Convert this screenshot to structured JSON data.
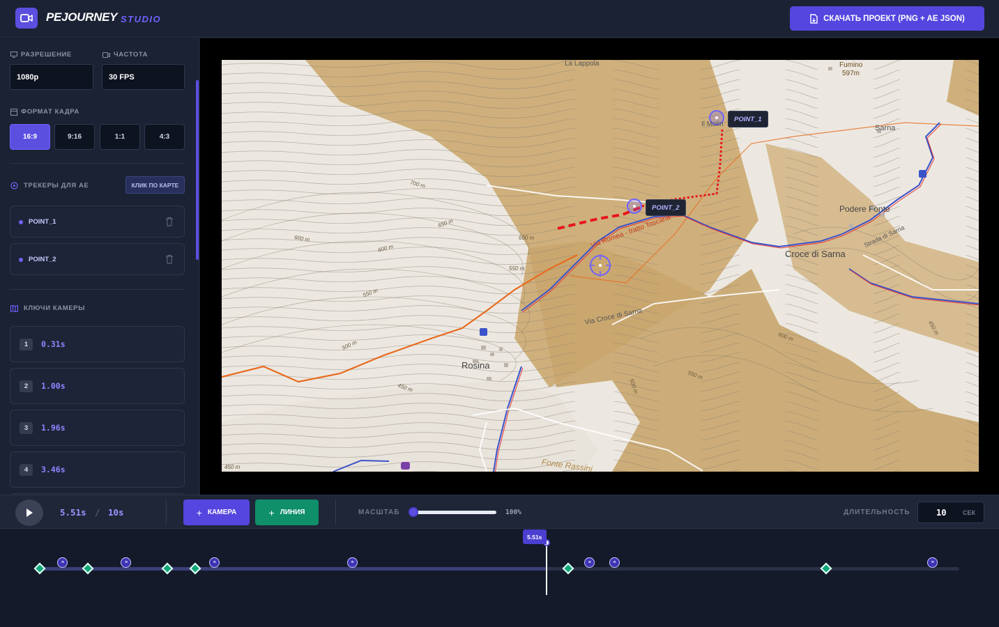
{
  "header": {
    "brand": "PEJOURNEY",
    "brand_sub": "STUDIO",
    "download_label": "СКАЧАТЬ ПРОЕКТ (PNG + AE JSON)"
  },
  "sidebar": {
    "resolution_label": "РАЗРЕШЕНИЕ",
    "resolution_value": "1080p",
    "fps_label": "ЧАСТОТА",
    "fps_value": "30 FPS",
    "frame_label": "ФОРМАТ КАДРА",
    "ratios": [
      "16:9",
      "9:16",
      "1:1",
      "4:3"
    ],
    "active_ratio": "16:9",
    "trackers_label": "ТРЕКЕРЫ ДЛЯ AE",
    "map_click_label": "КЛИК ПО КАРТЕ",
    "trackers": [
      {
        "name": "POINT_1"
      },
      {
        "name": "POINT_2"
      }
    ],
    "keys_label": "КЛЮЧИ КАМЕРЫ",
    "keys": [
      {
        "index": "1",
        "time": "0.31s"
      },
      {
        "index": "2",
        "time": "1.00s"
      },
      {
        "index": "3",
        "time": "1.96s"
      },
      {
        "index": "4",
        "time": "3.46s"
      }
    ]
  },
  "map": {
    "labels": {
      "lappola": "La Lappola",
      "fumino": "Fumino",
      "fumino_alt": "597m",
      "molino": "Il Molin",
      "sarna": "Sarna",
      "podere": "Podere Fonte",
      "croce": "Croce di Sarna",
      "rosina": "Rosina",
      "via_romea": "Via Romea - tratto Toscana",
      "via_croce": "Via Croce di Sarna",
      "strada": "Strada di Sarna",
      "fonte": "Fonte Rassini"
    },
    "contours": {
      "c700": "700 m",
      "c650": "650 m",
      "c600a": "600 m",
      "c600b": "600 m",
      "c600c": "600 m",
      "c600d": "600 m",
      "c550a": "550 m",
      "c550b": "550 m",
      "c550c": "550 m",
      "c500a": "500 m",
      "c500b": "500 m",
      "c450a": "450 m",
      "c450b": "450 m",
      "c450c": "450 m"
    },
    "trackers": [
      "POINT_1",
      "POINT_2"
    ]
  },
  "controls": {
    "current_time": "5.51s",
    "separator": "/",
    "total_time": "10s",
    "camera_label": "КАМЕРА",
    "line_label": "ЛИНИЯ",
    "scale_label": "МАСШТАБ",
    "scale_value": "100%",
    "scale_fraction": 0.0,
    "duration_label": "ДЛИТЕЛЬНОСТЬ",
    "duration_value": "10",
    "duration_unit": "СЕК"
  },
  "timeline": {
    "playhead_label": "5.51s",
    "playhead_time": 5.51,
    "duration": 10,
    "line_keys": [
      0.0,
      0.52,
      1.39,
      1.69,
      5.75,
      8.55
    ],
    "camera_keys": [
      0.25,
      0.94,
      1.9,
      3.4,
      5.98,
      6.25,
      9.71
    ]
  },
  "colors": {
    "accent": "#5b4fe0",
    "green": "#0f8f6a",
    "route_red": "#e8151b",
    "panel": "#1b2233"
  }
}
